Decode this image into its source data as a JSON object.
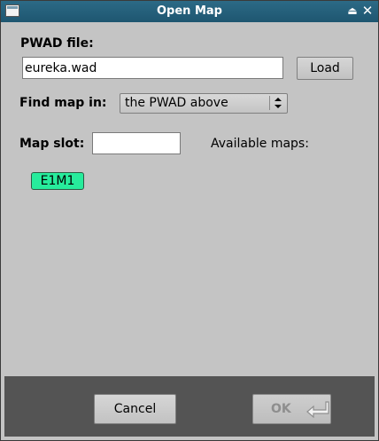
{
  "window": {
    "title": "Open Map"
  },
  "titlebar": {
    "shade_glyph": "⏏",
    "close_glyph": "✕"
  },
  "pwad": {
    "label": "PWAD file:",
    "value": "eureka.wad",
    "load_label": "Load"
  },
  "find_map": {
    "label": "Find map in:",
    "selected": "the PWAD above"
  },
  "map_slot": {
    "label": "Map slot:",
    "value": ""
  },
  "available": {
    "label": "Available maps:",
    "maps": [
      "E1M1"
    ],
    "chip_color": "#27ec9c"
  },
  "footer": {
    "cancel_label": "Cancel",
    "ok_label": "OK",
    "ok_enabled": false
  },
  "colors": {
    "titlebar": "#1e5670",
    "background": "#c4c4c4",
    "footer": "#545454"
  }
}
